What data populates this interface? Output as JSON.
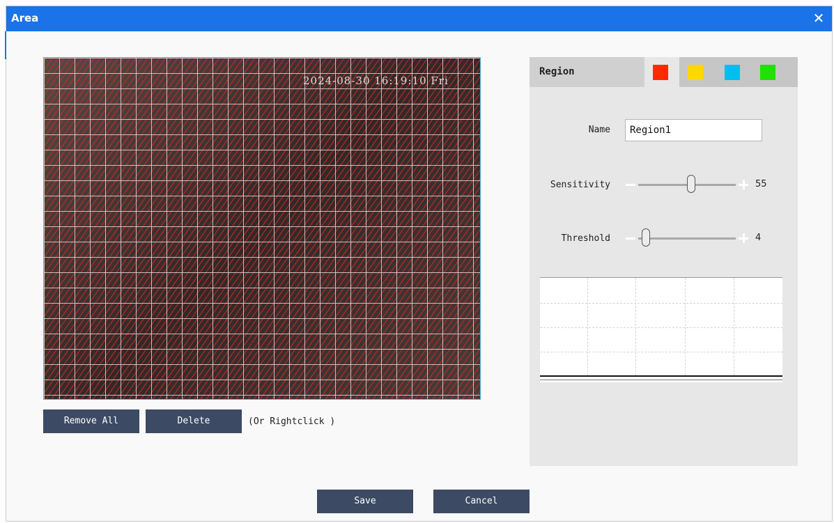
{
  "dialog": {
    "title": "Area",
    "close_icon": "close-icon"
  },
  "video": {
    "osd_text": "2024-08-30 16:19:10 Fri"
  },
  "actions": {
    "remove_all": "Remove All",
    "delete": "Delete",
    "hint": "(Or Rightclick )"
  },
  "panel": {
    "region_label": "Region",
    "color_tabs": [
      {
        "name": "red",
        "color": "#ff2a00",
        "selected": true
      },
      {
        "name": "yellow",
        "color": "#ffd800",
        "selected": false
      },
      {
        "name": "cyan",
        "color": "#00bff0",
        "selected": false
      },
      {
        "name": "green",
        "color": "#22e000",
        "selected": false
      }
    ],
    "name_label": "Name",
    "name_value": "Region1",
    "sensitivity_label": "Sensitivity",
    "sensitivity_value": "55",
    "sensitivity_level": 55,
    "threshold_label": "Threshold",
    "threshold_value": "4",
    "threshold_level": 4
  },
  "footer": {
    "save": "Save",
    "cancel": "Cancel"
  }
}
